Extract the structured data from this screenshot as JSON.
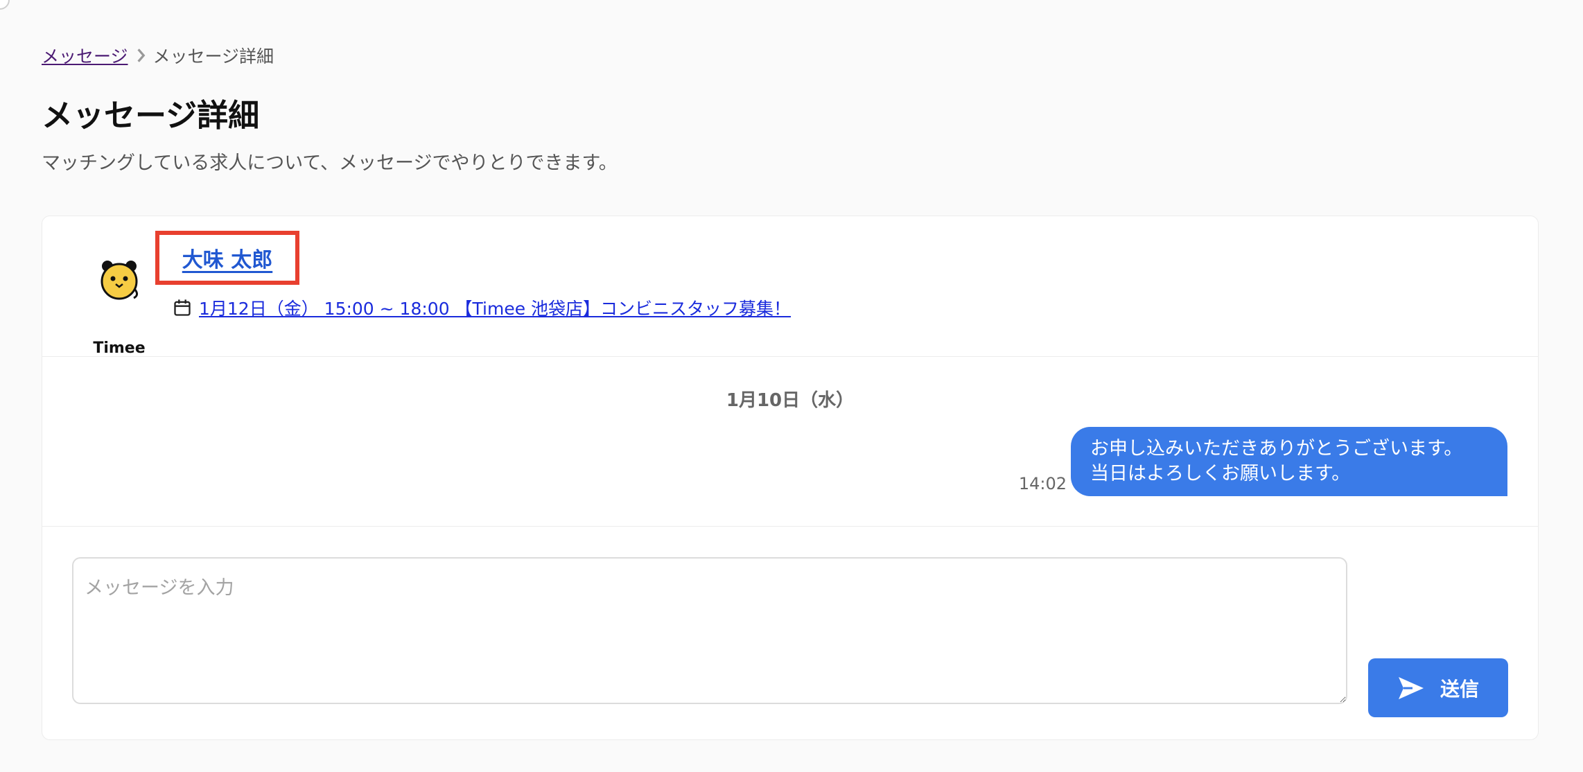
{
  "breadcrumb": {
    "parent": "メッセージ",
    "current": "メッセージ詳細"
  },
  "page": {
    "title": "メッセージ詳細",
    "subtitle": "マッチングしている求人について、メッセージでやりとりできます。"
  },
  "header": {
    "logo_text": "Timee",
    "user_name": "大味 太郎",
    "job_link": "1月12日（金） 15:00 ~ 18:00 【Timee 池袋店】コンビニスタッフ募集！"
  },
  "conversation": {
    "date_label": "1月10日（水）",
    "messages": [
      {
        "line1": "お申し込みいただきありがとうございます。",
        "line2": "当日はよろしくお願いします。",
        "time": "14:02"
      }
    ]
  },
  "composer": {
    "placeholder": "メッセージを入力",
    "value": "",
    "send_label": "送信"
  },
  "colors": {
    "accent": "#3a7be8",
    "highlight_box": "#e8402f",
    "name_link": "#2158d1",
    "job_link": "#1a2bdc"
  },
  "icons": {
    "breadcrumb_separator": "chevron-right-icon",
    "calendar": "calendar-icon",
    "send": "send-icon",
    "logo": "timee-mascot-icon"
  }
}
